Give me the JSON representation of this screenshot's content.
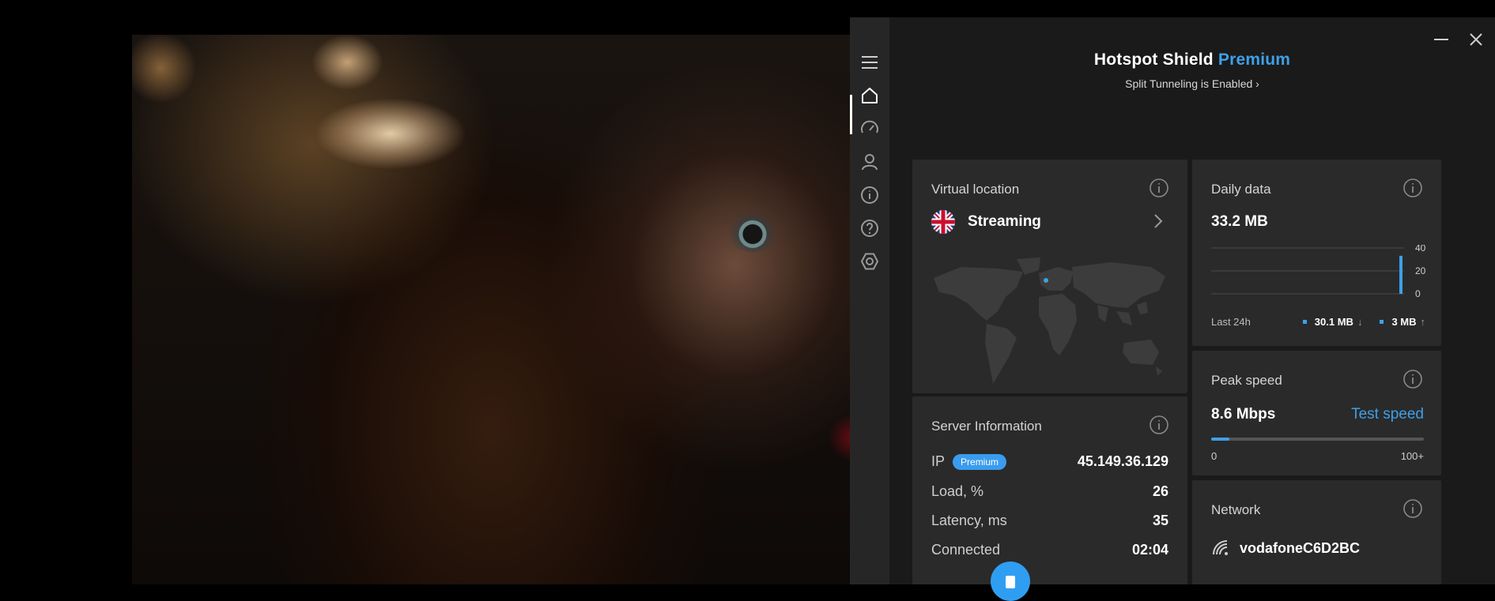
{
  "app": {
    "brand_name": "Hotspot Shield",
    "brand_tier": "Premium",
    "split_tunneling": "Split Tunneling is Enabled",
    "split_chevron": "›",
    "accent_color": "#3ea0e8"
  },
  "sidebar": {
    "items": [
      {
        "icon": "menu-icon"
      },
      {
        "icon": "home-icon",
        "active": true
      },
      {
        "icon": "speedometer-icon"
      },
      {
        "icon": "account-icon"
      },
      {
        "icon": "info-icon"
      },
      {
        "icon": "help-icon"
      },
      {
        "icon": "settings-icon"
      }
    ]
  },
  "virtual_location": {
    "title": "Virtual location",
    "location": "Streaming",
    "flag": "uk-flag-icon"
  },
  "server_info": {
    "title": "Server Information",
    "ip_label": "IP",
    "ip_badge": "Premium",
    "ip_value": "45.149.36.129",
    "load_label": "Load, %",
    "load_value": "26",
    "latency_label": "Latency, ms",
    "latency_value": "35",
    "connected_label": "Connected",
    "connected_value": "02:04"
  },
  "daily_data": {
    "title": "Daily data",
    "total": "33.2 MB",
    "period": "Last 24h",
    "download": "30.1 MB",
    "download_arrow": "↓",
    "upload": "3 MB",
    "upload_arrow": "↑",
    "chart_data": {
      "type": "bar",
      "ylim": [
        0,
        40
      ],
      "yticks": [
        "40",
        "20",
        "0"
      ],
      "values": [
        0,
        0,
        0,
        0,
        0,
        0,
        0,
        0,
        0,
        0,
        0,
        0,
        0,
        0,
        0,
        0,
        0,
        0,
        0,
        0,
        0,
        0,
        0,
        33.2
      ]
    }
  },
  "peak_speed": {
    "title": "Peak speed",
    "value": "8.6 Mbps",
    "test_speed": "Test speed",
    "min_label": "0",
    "max_label": "100+",
    "level": 0.086
  },
  "network": {
    "title": "Network",
    "name": "vodafoneC6D2BC"
  }
}
